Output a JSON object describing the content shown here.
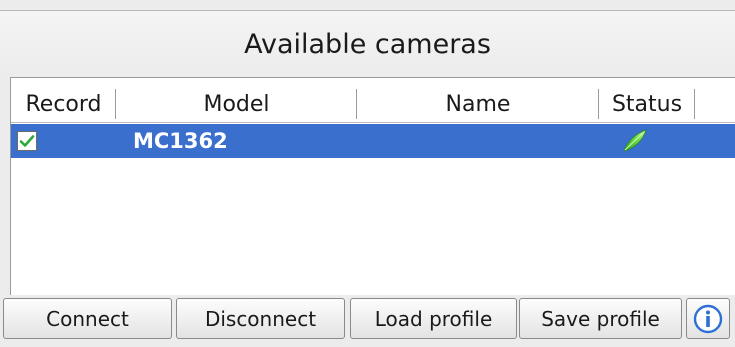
{
  "title": "Available cameras",
  "table": {
    "columns": [
      "Record",
      "Model",
      "Name",
      "Status"
    ],
    "rows": [
      {
        "record_checked": true,
        "model": "MC1362",
        "name": "",
        "status_icon": "green-ok-icon",
        "selected": true
      }
    ]
  },
  "buttons": {
    "connect": "Connect",
    "disconnect": "Disconnect",
    "load_profile": "Load profile",
    "save_profile": "Save profile",
    "info_icon": "info-icon"
  },
  "colors": {
    "selection": "#3a6fce",
    "status_ok": "#4cd137",
    "info_blue": "#2d6fd6"
  }
}
